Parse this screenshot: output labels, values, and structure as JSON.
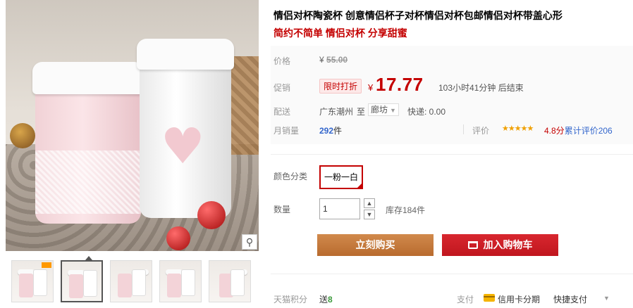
{
  "product": {
    "title": "情侣对杯陶瓷杯 创意情侣杯子对杯情侣对杯包邮情侣对杯带盖心形",
    "subtitle": "简约不简单 情侣对杯 分享甜蜜"
  },
  "gallery": {
    "zoom_icon": "magnifier-icon",
    "thumbnail_count": 5,
    "active_thumbnail": 2
  },
  "price": {
    "label": "价格",
    "currency": "¥",
    "original": "55.00"
  },
  "promo": {
    "label": "促销",
    "tag": "限时打折",
    "currency": "¥",
    "price": "17.77",
    "countdown": "103小时41分钟 后结束"
  },
  "shipping": {
    "label": "配送",
    "from": "广东潮州",
    "to_word": "至",
    "destination": "廊坊",
    "fee": "快递: 0.00"
  },
  "sales": {
    "label": "月销量",
    "count": "292",
    "unit": "件"
  },
  "review": {
    "label": "评价",
    "stars": "★★★★★",
    "score": "4.8分",
    "link_text": "累计评价206"
  },
  "sku": {
    "label": "颜色分类",
    "option": "一粉一白"
  },
  "quantity": {
    "label": "数量",
    "value": "1",
    "stock": "库存184件"
  },
  "actions": {
    "buy_now": "立刻购买",
    "add_to_cart": "加入购物车"
  },
  "points": {
    "label": "天猫积分",
    "prefix": "送",
    "value": "8"
  },
  "payment": {
    "label": "支付",
    "credit_card": "信用卡分期",
    "express": "快捷支付"
  },
  "colors": {
    "accent_red": "#c40000",
    "buy_button": "#c47a3c",
    "cart_button": "#d8272f",
    "link_blue": "#3366cc"
  }
}
